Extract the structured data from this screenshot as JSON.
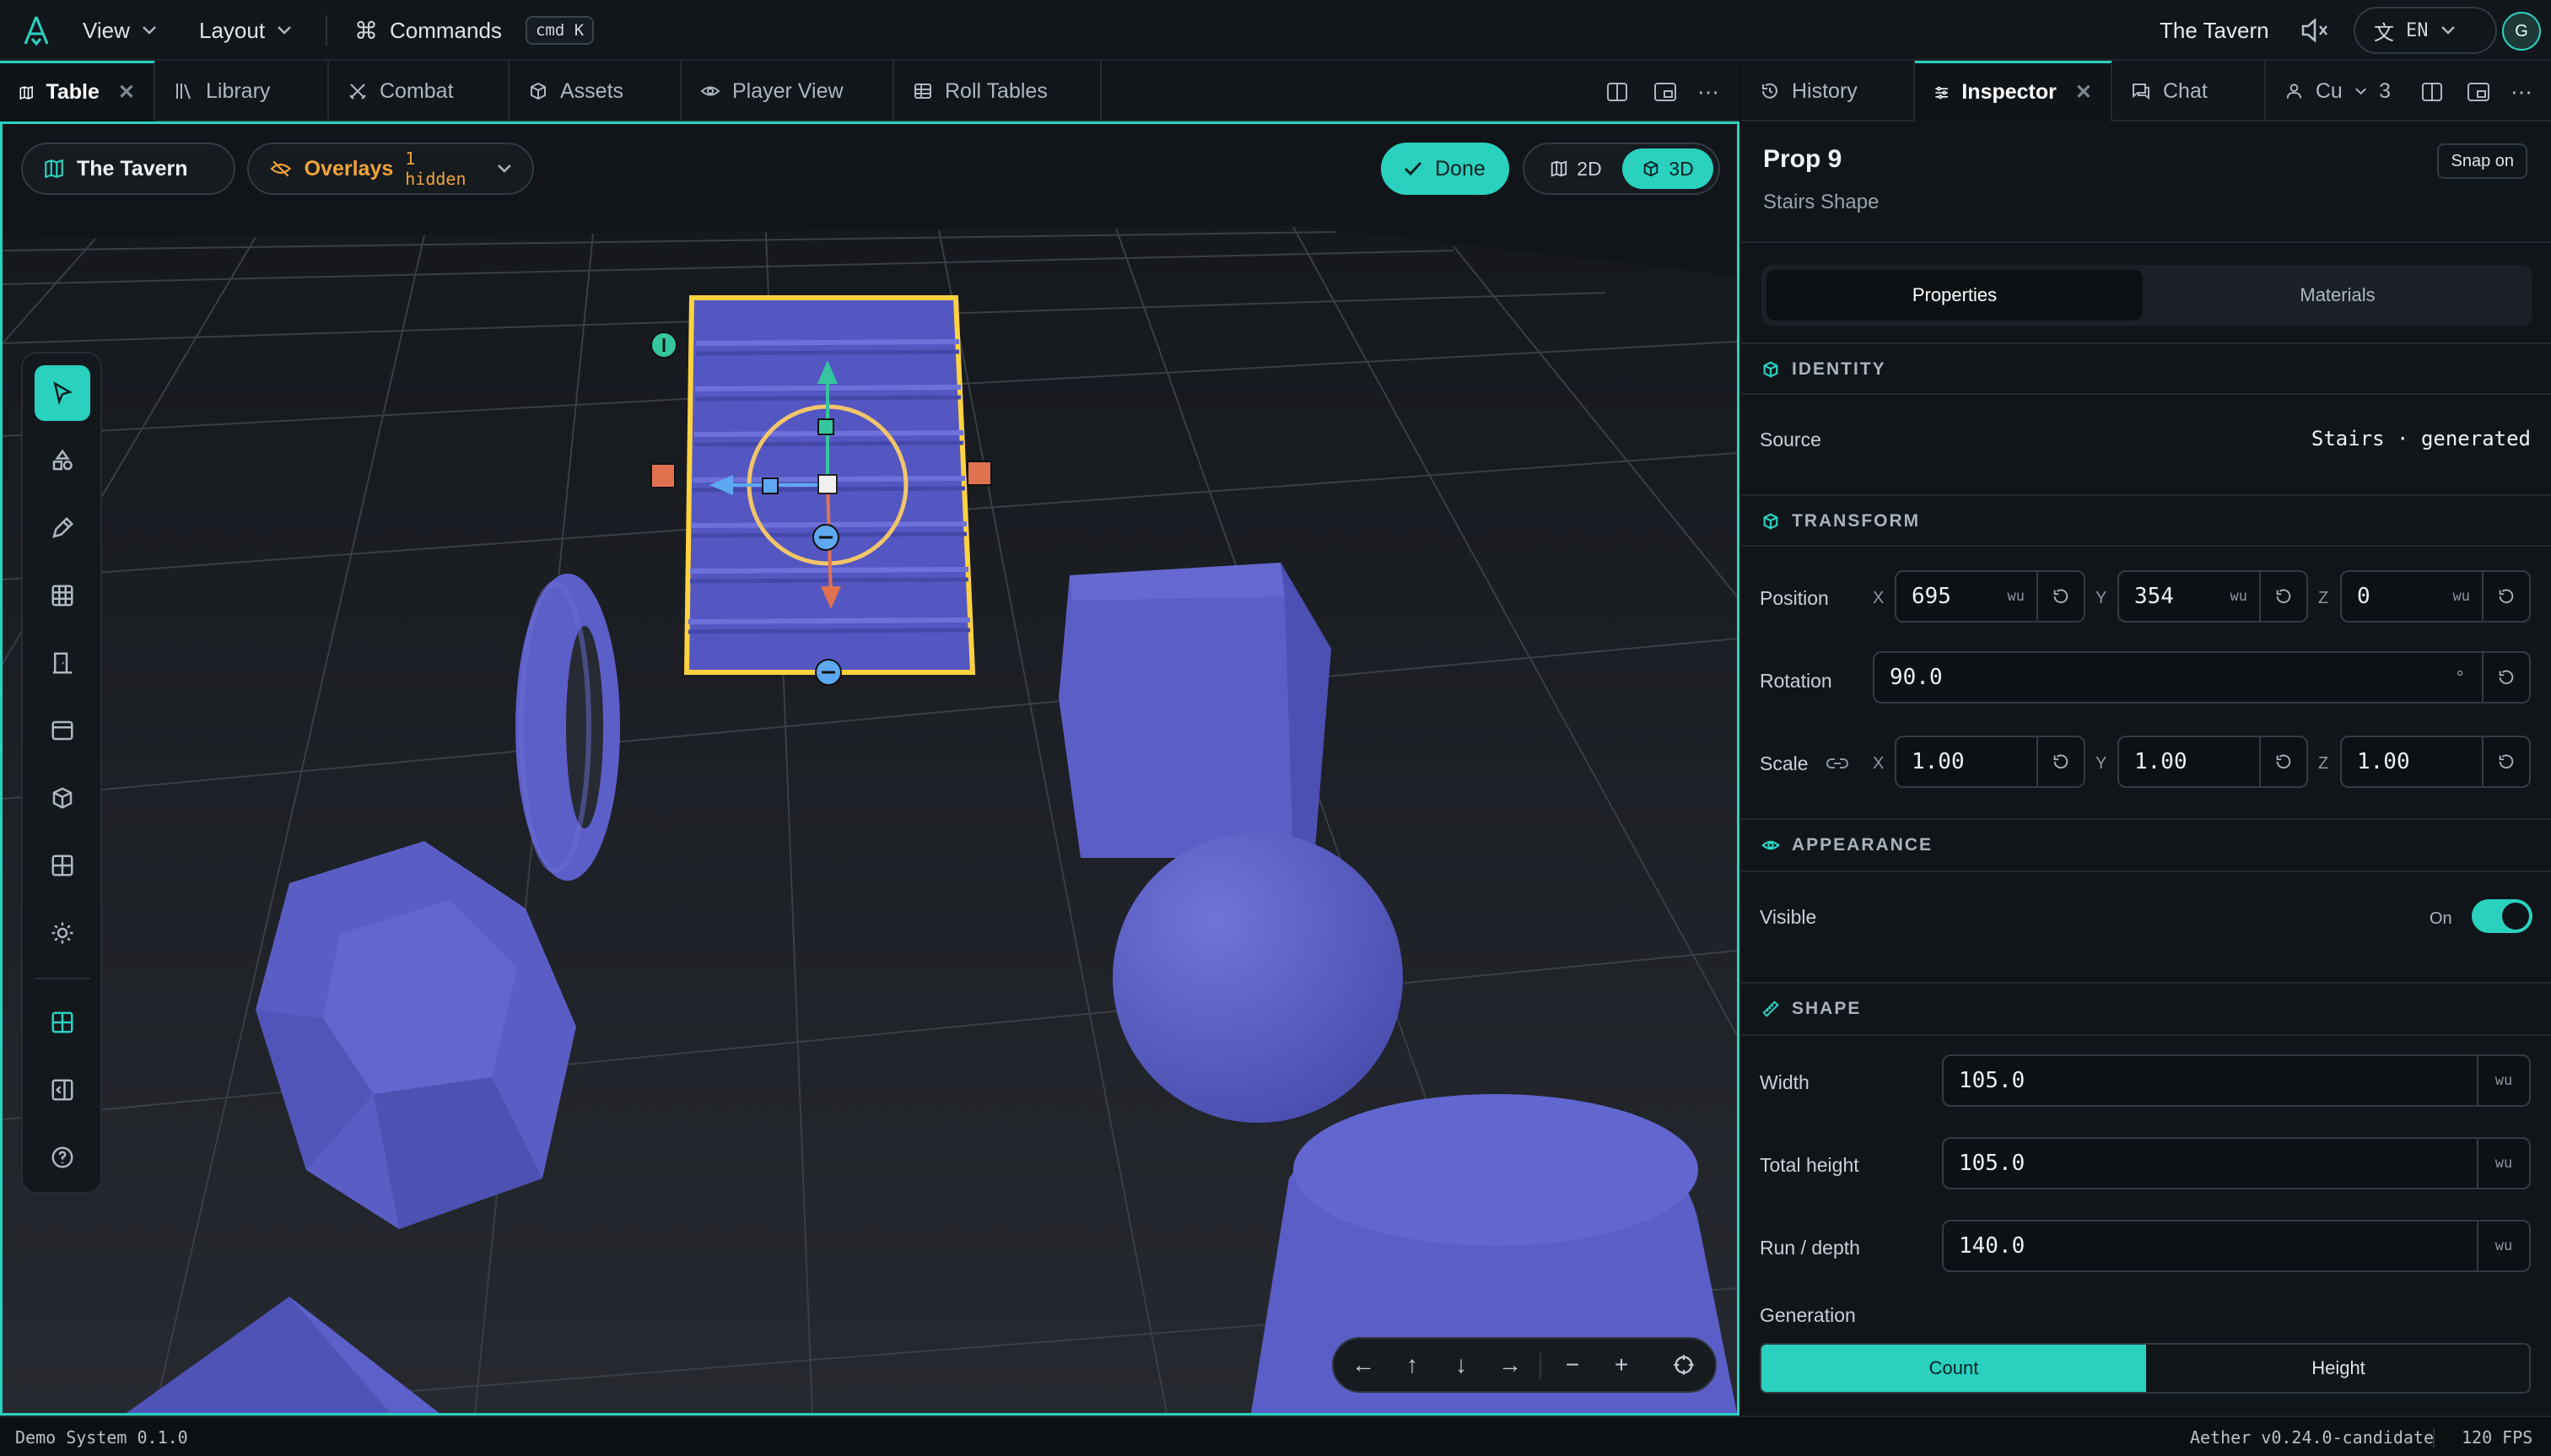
{
  "topbar": {
    "view_label": "View",
    "layout_label": "Layout",
    "commands_label": "Commands",
    "commands_shortcut": "cmd K",
    "scene_name": "The Tavern",
    "language": "EN",
    "avatar_initial": "G"
  },
  "tabs_left": [
    {
      "label": "Table",
      "icon": "map-icon",
      "active": true
    },
    {
      "label": "Library",
      "icon": "library-icon"
    },
    {
      "label": "Combat",
      "icon": "swords-icon"
    },
    {
      "label": "Assets",
      "icon": "box-icon"
    },
    {
      "label": "Player View",
      "icon": "eye-icon"
    },
    {
      "label": "Roll Tables",
      "icon": "table-icon"
    }
  ],
  "tabs_right": [
    {
      "label": "History",
      "icon": "history-icon"
    },
    {
      "label": "Inspector",
      "icon": "sliders-icon",
      "active": true
    },
    {
      "label": "Chat",
      "icon": "chat-icon"
    },
    {
      "label": "Cu",
      "icon": "users-icon",
      "count": "3"
    }
  ],
  "viewport": {
    "scene_pill": "The Tavern",
    "overlays_label": "Overlays",
    "overlays_hidden": "1 hidden",
    "done_label": "Done",
    "mode_2d": "2D",
    "mode_3d": "3D",
    "active_mode": "3D"
  },
  "tools": [
    {
      "name": "select-tool",
      "icon": "cursor-icon",
      "active": true
    },
    {
      "name": "shapes-tool",
      "icon": "shapes-icon"
    },
    {
      "name": "draw-tool",
      "icon": "pen-icon"
    },
    {
      "name": "grid-tool",
      "icon": "grid-icon"
    },
    {
      "name": "door-tool",
      "icon": "door-icon"
    },
    {
      "name": "panel-tool",
      "icon": "panel-icon"
    },
    {
      "name": "prop-tool",
      "icon": "cube-icon"
    },
    {
      "name": "tile-tool",
      "icon": "tiles-icon"
    },
    {
      "name": "light-tool",
      "icon": "sun-icon"
    },
    {
      "name": "map-grid-tool",
      "icon": "map-grid-icon"
    },
    {
      "name": "sidebar-tool",
      "icon": "sidebar-icon"
    },
    {
      "name": "help-tool",
      "icon": "help-icon"
    }
  ],
  "inspector": {
    "title": "Prop 9",
    "subtitle": "Stairs Shape",
    "snap_label": "Snap on",
    "tab_properties": "Properties",
    "tab_materials": "Materials",
    "identity": {
      "title": "IDENTITY",
      "source_label": "Source",
      "source_value": "Stairs · generated"
    },
    "transform": {
      "title": "TRANSFORM",
      "position_label": "Position",
      "pos_x": "695",
      "pos_y": "354",
      "pos_z": "0",
      "rotation_label": "Rotation",
      "rotation": "90.0",
      "rotation_unit": "°",
      "scale_label": "Scale",
      "scale_x": "1.00",
      "scale_y": "1.00",
      "scale_z": "1.00",
      "unit": "wu",
      "axis_x": "X",
      "axis_y": "Y",
      "axis_z": "Z"
    },
    "appearance": {
      "title": "APPEARANCE",
      "visible_label": "Visible",
      "visible_state": "On"
    },
    "shape": {
      "title": "SHAPE",
      "width_label": "Width",
      "width": "105.0",
      "height_label": "Total height",
      "height": "105.0",
      "depth_label": "Run / depth",
      "depth": "140.0",
      "unit": "wu",
      "generation_label": "Generation",
      "gen_count": "Count",
      "gen_height": "Height",
      "gen_active": "Count"
    }
  },
  "statusbar": {
    "left": "Demo System 0.1.0",
    "version": "Aether v0.24.0-candidate",
    "fps": "120 FPS"
  },
  "colors": {
    "accent": "#2ad1bf",
    "overlay_warning": "#f0a33a",
    "prop_fill": "#5b5fc7",
    "selection_outline": "#ffd23f"
  }
}
